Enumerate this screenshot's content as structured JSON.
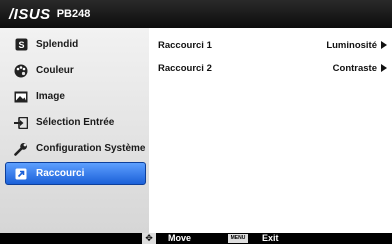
{
  "header": {
    "brand": "/ISUS",
    "model": "PB248"
  },
  "sidebar": {
    "items": [
      {
        "label": "Splendid",
        "icon": "splendid-icon"
      },
      {
        "label": "Couleur",
        "icon": "palette-icon"
      },
      {
        "label": "Image",
        "icon": "image-icon"
      },
      {
        "label": "Sélection Entrée",
        "icon": "input-icon"
      },
      {
        "label": "Configuration Système",
        "icon": "wrench-icon"
      },
      {
        "label": "Raccourci",
        "icon": "shortcut-icon",
        "selected": true
      }
    ]
  },
  "content": {
    "rows": [
      {
        "label": "Raccourci 1",
        "value": "Luminosité"
      },
      {
        "label": "Raccourci 2",
        "value": "Contraste"
      }
    ]
  },
  "footer": {
    "move_label": "Move",
    "menu_key": "MENU",
    "exit_label": "Exit"
  },
  "colors": {
    "accent": "#2a6fe0",
    "header": "#111111",
    "sidebar": "#e6e6e6"
  }
}
